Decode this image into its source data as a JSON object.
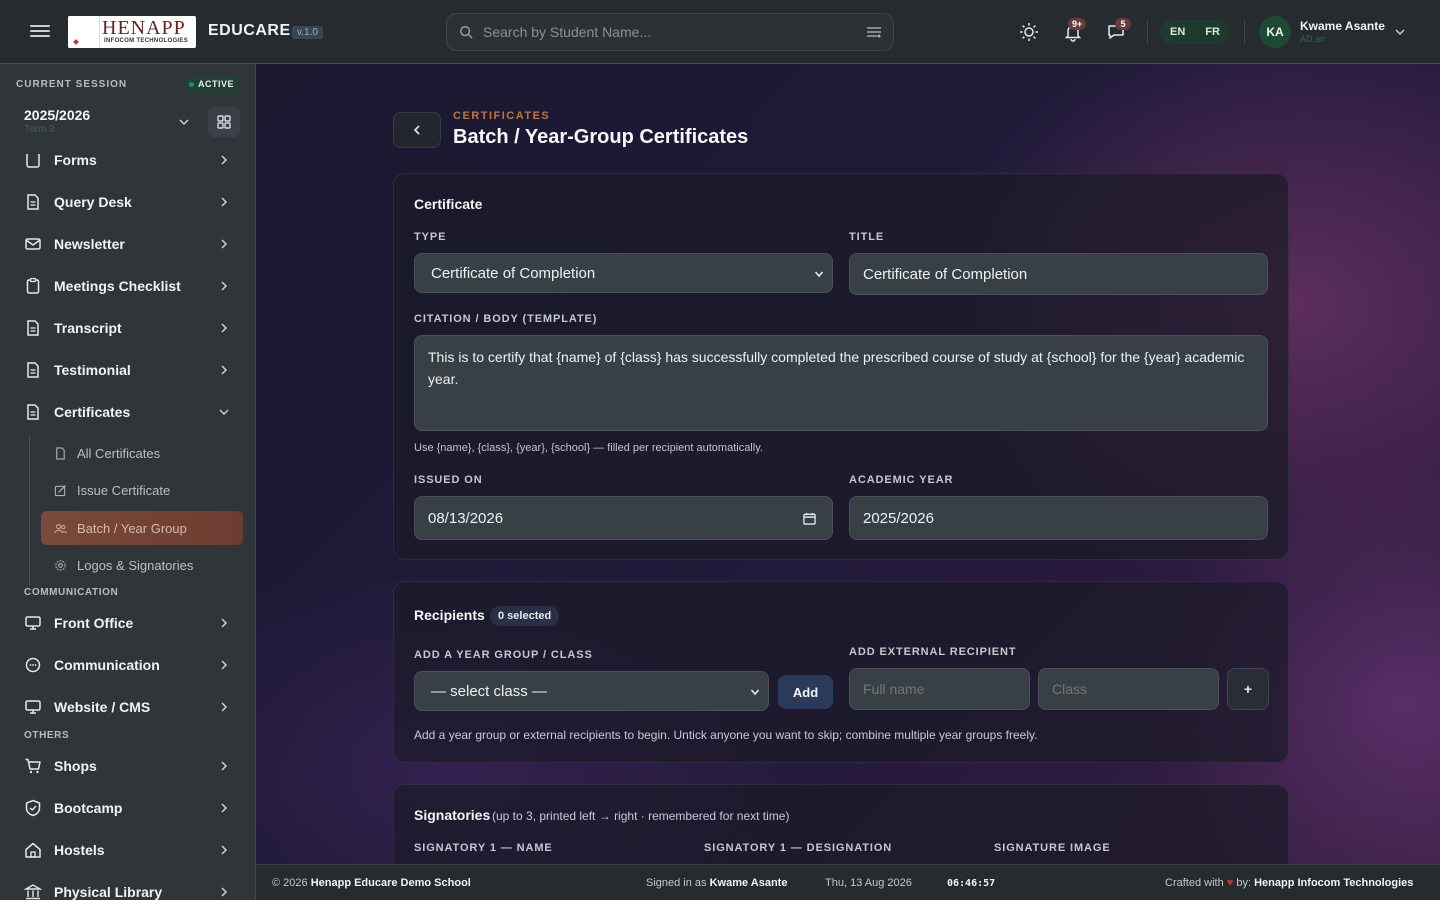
{
  "topbar": {
    "logo_text": "HENAPP",
    "logo_sub": "INFOCOM TECHNOLOGIES",
    "brand": "EDUCARE",
    "version": "v.1.0",
    "search_placeholder": "Search by Student Name...",
    "notifications_badge": "9+",
    "messages_badge": "5",
    "lang_en": "EN",
    "lang_fr": "FR",
    "user_initials": "KA",
    "user_name": "Kwame Asante",
    "user_role": "AD.ari"
  },
  "session": {
    "label": "CURRENT SESSION",
    "status": "ACTIVE",
    "year": "2025/2026",
    "term": "Term 3"
  },
  "sidebar": {
    "items": [
      {
        "label": "Forms",
        "icon": "form-icon"
      },
      {
        "label": "Query Desk",
        "icon": "document-icon"
      },
      {
        "label": "Newsletter",
        "icon": "mail-icon"
      },
      {
        "label": "Meetings Checklist",
        "icon": "clipboard-icon"
      },
      {
        "label": "Transcript",
        "icon": "document-icon"
      },
      {
        "label": "Testimonial",
        "icon": "document-icon"
      },
      {
        "label": "Certificates",
        "icon": "document-icon"
      }
    ],
    "certificates_sub": [
      {
        "label": "All Certificates",
        "icon": "document-icon"
      },
      {
        "label": "Issue Certificate",
        "icon": "edit-icon"
      },
      {
        "label": "Batch / Year Group",
        "icon": "users-icon"
      },
      {
        "label": "Logos & Signatories",
        "icon": "gear-icon"
      }
    ],
    "section_communication": "COMMUNICATION",
    "communication_items": [
      {
        "label": "Front Office",
        "icon": "monitor-icon"
      },
      {
        "label": "Communication",
        "icon": "chat-icon"
      },
      {
        "label": "Website / CMS",
        "icon": "monitor-icon"
      }
    ],
    "section_others": "OTHERS",
    "others_items": [
      {
        "label": "Shops",
        "icon": "cart-icon"
      },
      {
        "label": "Bootcamp",
        "icon": "shield-icon"
      },
      {
        "label": "Hostels",
        "icon": "home-icon"
      },
      {
        "label": "Physical Library",
        "icon": "library-icon"
      }
    ]
  },
  "page": {
    "kicker": "CERTIFICATES",
    "title": "Batch / Year-Group Certificates"
  },
  "certificate": {
    "title": "Certificate",
    "type_label": "TYPE",
    "type_value": "Certificate of Completion",
    "title_label": "TITLE",
    "title_value": "Certificate of Completion",
    "citation_label": "CITATION / BODY (TEMPLATE)",
    "citation_value": "This is to certify that {name} of {class} has successfully completed the prescribed course of study at {school} for the {year} academic year.",
    "citation_hint": "Use {name}, {class}, {year}, {school} — filled per recipient automatically.",
    "issued_label": "ISSUED ON",
    "issued_value": "08/13/2026",
    "academic_label": "ACADEMIC YEAR",
    "academic_value": "2025/2026"
  },
  "recipients": {
    "title": "Recipients",
    "count": "0 selected",
    "group_label": "ADD A YEAR GROUP / CLASS",
    "group_select": "— select class —",
    "add_button": "Add",
    "external_label": "ADD EXTERNAL RECIPIENT",
    "fullname_placeholder": "Full name",
    "class_placeholder": "Class",
    "plus_button": "+",
    "hint": "Add a year group or external recipients to begin. Untick anyone you want to skip; combine multiple year groups freely."
  },
  "signatories": {
    "title": "Signatories",
    "subtitle": "(up to 3, printed left → right · remembered for next time)",
    "name_label": "SIGNATORY 1 — NAME",
    "designation_label": "SIGNATORY 1 — DESIGNATION",
    "image_label": "SIGNATURE IMAGE"
  },
  "footer": {
    "copyright_prefix": "© 2026",
    "school": "Henapp Educare Demo School",
    "signed_prefix": "Signed in as",
    "signed_user": "Kwame Asante",
    "date": "Thu, 13 Aug 2026",
    "time": "06:46:57",
    "crafted_prefix": "Crafted with",
    "crafted_by": "by:",
    "company": "Henapp Infocom Technologies"
  },
  "colors": {
    "accent_green": "#2f8a5e",
    "accent_orange": "#c0753c",
    "active_item": "#7a4a3a"
  }
}
